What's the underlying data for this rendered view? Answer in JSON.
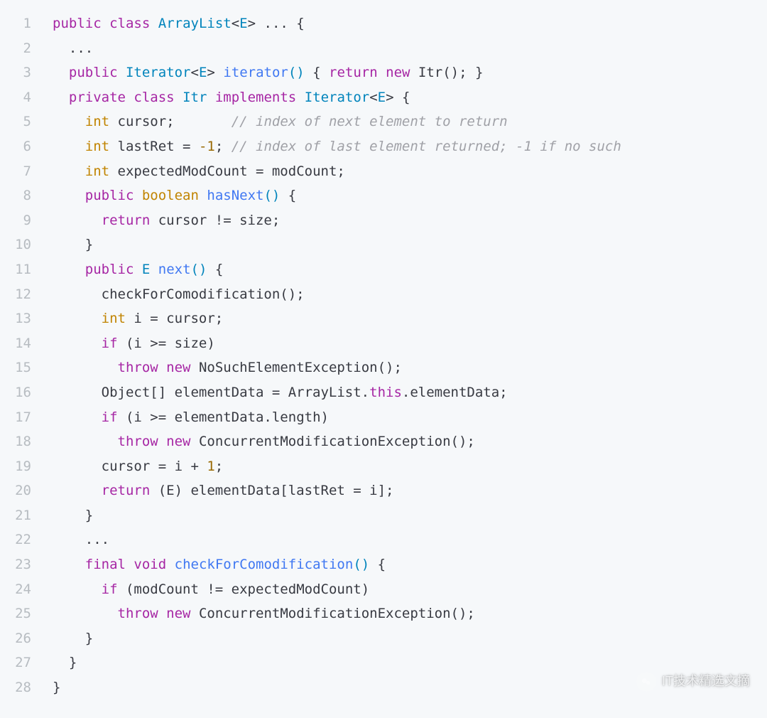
{
  "lineNumbers": [
    "1",
    "2",
    "3",
    "4",
    "5",
    "6",
    "7",
    "8",
    "9",
    "10",
    "11",
    "12",
    "13",
    "14",
    "15",
    "16",
    "17",
    "18",
    "19",
    "20",
    "21",
    "22",
    "23",
    "24",
    "25",
    "26",
    "27",
    "28"
  ],
  "code": {
    "lines": [
      [
        {
          "t": "public",
          "c": "kw"
        },
        {
          "t": " ",
          "c": "plain"
        },
        {
          "t": "class",
          "c": "kw"
        },
        {
          "t": " ",
          "c": "plain"
        },
        {
          "t": "ArrayList",
          "c": "typedecl"
        },
        {
          "t": "<",
          "c": "plain"
        },
        {
          "t": "E",
          "c": "typedecl"
        },
        {
          "t": ">",
          "c": "plain"
        },
        {
          "t": " ... {",
          "c": "plain"
        }
      ],
      [
        {
          "t": "  ...",
          "c": "plain"
        }
      ],
      [
        {
          "t": "  ",
          "c": "plain"
        },
        {
          "t": "public",
          "c": "kw"
        },
        {
          "t": " ",
          "c": "plain"
        },
        {
          "t": "Iterator",
          "c": "typedecl"
        },
        {
          "t": "<",
          "c": "plain"
        },
        {
          "t": "E",
          "c": "typedecl"
        },
        {
          "t": ">",
          "c": "plain"
        },
        {
          "t": " ",
          "c": "plain"
        },
        {
          "t": "iterator",
          "c": "fn"
        },
        {
          "t": "()",
          "c": "op"
        },
        {
          "t": " { ",
          "c": "plain"
        },
        {
          "t": "return",
          "c": "kw"
        },
        {
          "t": " ",
          "c": "plain"
        },
        {
          "t": "new",
          "c": "kw"
        },
        {
          "t": " Itr(); }",
          "c": "plain"
        }
      ],
      [
        {
          "t": "  ",
          "c": "plain"
        },
        {
          "t": "private",
          "c": "kw"
        },
        {
          "t": " ",
          "c": "plain"
        },
        {
          "t": "class",
          "c": "kw"
        },
        {
          "t": " ",
          "c": "plain"
        },
        {
          "t": "Itr",
          "c": "typedecl"
        },
        {
          "t": " ",
          "c": "plain"
        },
        {
          "t": "implements",
          "c": "kw"
        },
        {
          "t": " ",
          "c": "plain"
        },
        {
          "t": "Iterator",
          "c": "typedecl"
        },
        {
          "t": "<",
          "c": "plain"
        },
        {
          "t": "E",
          "c": "typedecl"
        },
        {
          "t": ">",
          "c": "plain"
        },
        {
          "t": " {",
          "c": "plain"
        }
      ],
      [
        {
          "t": "    ",
          "c": "plain"
        },
        {
          "t": "int",
          "c": "type"
        },
        {
          "t": " cursor;       ",
          "c": "plain"
        },
        {
          "t": "// index of next element to return",
          "c": "cmt"
        }
      ],
      [
        {
          "t": "    ",
          "c": "plain"
        },
        {
          "t": "int",
          "c": "type"
        },
        {
          "t": " lastRet = ",
          "c": "plain"
        },
        {
          "t": "-1",
          "c": "num"
        },
        {
          "t": "; ",
          "c": "plain"
        },
        {
          "t": "// index of last element returned; -1 if no such",
          "c": "cmt"
        }
      ],
      [
        {
          "t": "    ",
          "c": "plain"
        },
        {
          "t": "int",
          "c": "type"
        },
        {
          "t": " expectedModCount = modCount;",
          "c": "plain"
        }
      ],
      [
        {
          "t": "    ",
          "c": "plain"
        },
        {
          "t": "public",
          "c": "kw"
        },
        {
          "t": " ",
          "c": "plain"
        },
        {
          "t": "boolean",
          "c": "type"
        },
        {
          "t": " ",
          "c": "plain"
        },
        {
          "t": "hasNext",
          "c": "fn"
        },
        {
          "t": "()",
          "c": "op"
        },
        {
          "t": " {",
          "c": "plain"
        }
      ],
      [
        {
          "t": "      ",
          "c": "plain"
        },
        {
          "t": "return",
          "c": "kw"
        },
        {
          "t": " cursor != size;",
          "c": "plain"
        }
      ],
      [
        {
          "t": "    }",
          "c": "plain"
        }
      ],
      [
        {
          "t": "    ",
          "c": "plain"
        },
        {
          "t": "public",
          "c": "kw"
        },
        {
          "t": " ",
          "c": "plain"
        },
        {
          "t": "E",
          "c": "typedecl"
        },
        {
          "t": " ",
          "c": "plain"
        },
        {
          "t": "next",
          "c": "fn"
        },
        {
          "t": "()",
          "c": "op"
        },
        {
          "t": " {",
          "c": "plain"
        }
      ],
      [
        {
          "t": "      checkForComodification();",
          "c": "plain"
        }
      ],
      [
        {
          "t": "      ",
          "c": "plain"
        },
        {
          "t": "int",
          "c": "type"
        },
        {
          "t": " i = cursor;",
          "c": "plain"
        }
      ],
      [
        {
          "t": "      ",
          "c": "plain"
        },
        {
          "t": "if",
          "c": "kw"
        },
        {
          "t": " (i >= size)",
          "c": "plain"
        }
      ],
      [
        {
          "t": "        ",
          "c": "plain"
        },
        {
          "t": "throw",
          "c": "kw"
        },
        {
          "t": " ",
          "c": "plain"
        },
        {
          "t": "new",
          "c": "kw"
        },
        {
          "t": " NoSuchElementException();",
          "c": "plain"
        }
      ],
      [
        {
          "t": "      Object[] elementData = ArrayList.",
          "c": "plain"
        },
        {
          "t": "this",
          "c": "kw"
        },
        {
          "t": ".elementData;",
          "c": "plain"
        }
      ],
      [
        {
          "t": "      ",
          "c": "plain"
        },
        {
          "t": "if",
          "c": "kw"
        },
        {
          "t": " (i >= elementData.length)",
          "c": "plain"
        }
      ],
      [
        {
          "t": "        ",
          "c": "plain"
        },
        {
          "t": "throw",
          "c": "kw"
        },
        {
          "t": " ",
          "c": "plain"
        },
        {
          "t": "new",
          "c": "kw"
        },
        {
          "t": " ConcurrentModificationException();",
          "c": "plain"
        }
      ],
      [
        {
          "t": "      cursor = i + ",
          "c": "plain"
        },
        {
          "t": "1",
          "c": "num"
        },
        {
          "t": ";",
          "c": "plain"
        }
      ],
      [
        {
          "t": "      ",
          "c": "plain"
        },
        {
          "t": "return",
          "c": "kw"
        },
        {
          "t": " (E) elementData[lastRet = i];",
          "c": "plain"
        }
      ],
      [
        {
          "t": "    }",
          "c": "plain"
        }
      ],
      [
        {
          "t": "    ...",
          "c": "plain"
        }
      ],
      [
        {
          "t": "    ",
          "c": "plain"
        },
        {
          "t": "final",
          "c": "kw"
        },
        {
          "t": " ",
          "c": "plain"
        },
        {
          "t": "void",
          "c": "kw"
        },
        {
          "t": " ",
          "c": "plain"
        },
        {
          "t": "checkForComodification",
          "c": "fn"
        },
        {
          "t": "()",
          "c": "op"
        },
        {
          "t": " {",
          "c": "plain"
        }
      ],
      [
        {
          "t": "      ",
          "c": "plain"
        },
        {
          "t": "if",
          "c": "kw"
        },
        {
          "t": " (modCount != expectedModCount)",
          "c": "plain"
        }
      ],
      [
        {
          "t": "        ",
          "c": "plain"
        },
        {
          "t": "throw",
          "c": "kw"
        },
        {
          "t": " ",
          "c": "plain"
        },
        {
          "t": "new",
          "c": "kw"
        },
        {
          "t": " ConcurrentModificationException();",
          "c": "plain"
        }
      ],
      [
        {
          "t": "    }",
          "c": "plain"
        }
      ],
      [
        {
          "t": "  }",
          "c": "plain"
        }
      ],
      [
        {
          "t": "}",
          "c": "plain"
        }
      ]
    ]
  },
  "watermark": {
    "text": "IT技术精选文摘"
  }
}
